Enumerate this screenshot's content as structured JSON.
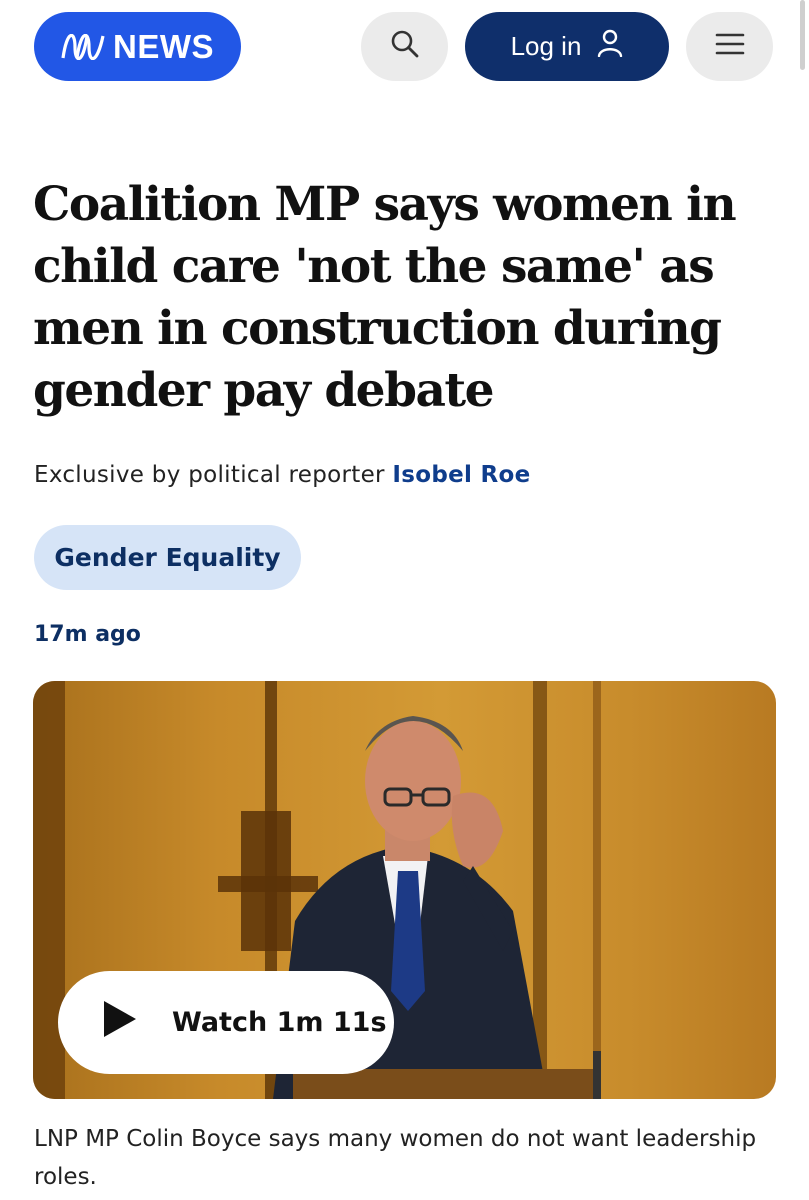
{
  "header": {
    "logo_text": "NEWS",
    "brand_color": "#2257e6",
    "login_label": "Log in",
    "search_icon": "search-icon",
    "user_icon": "user-icon",
    "menu_icon": "menu-icon"
  },
  "article": {
    "headline": "Coalition MP says women in child care 'not the same' as men in construction during gender pay debate",
    "byline_prefix": "Exclusive by political reporter",
    "byline_author": "Isobel Roe",
    "tag": "Gender Equality",
    "timestamp": "17m ago"
  },
  "video": {
    "watch_label": "Watch 1m 11s",
    "play_icon": "play-icon",
    "caption": "LNP MP Colin Boyce says many women do not want leadership roles."
  }
}
